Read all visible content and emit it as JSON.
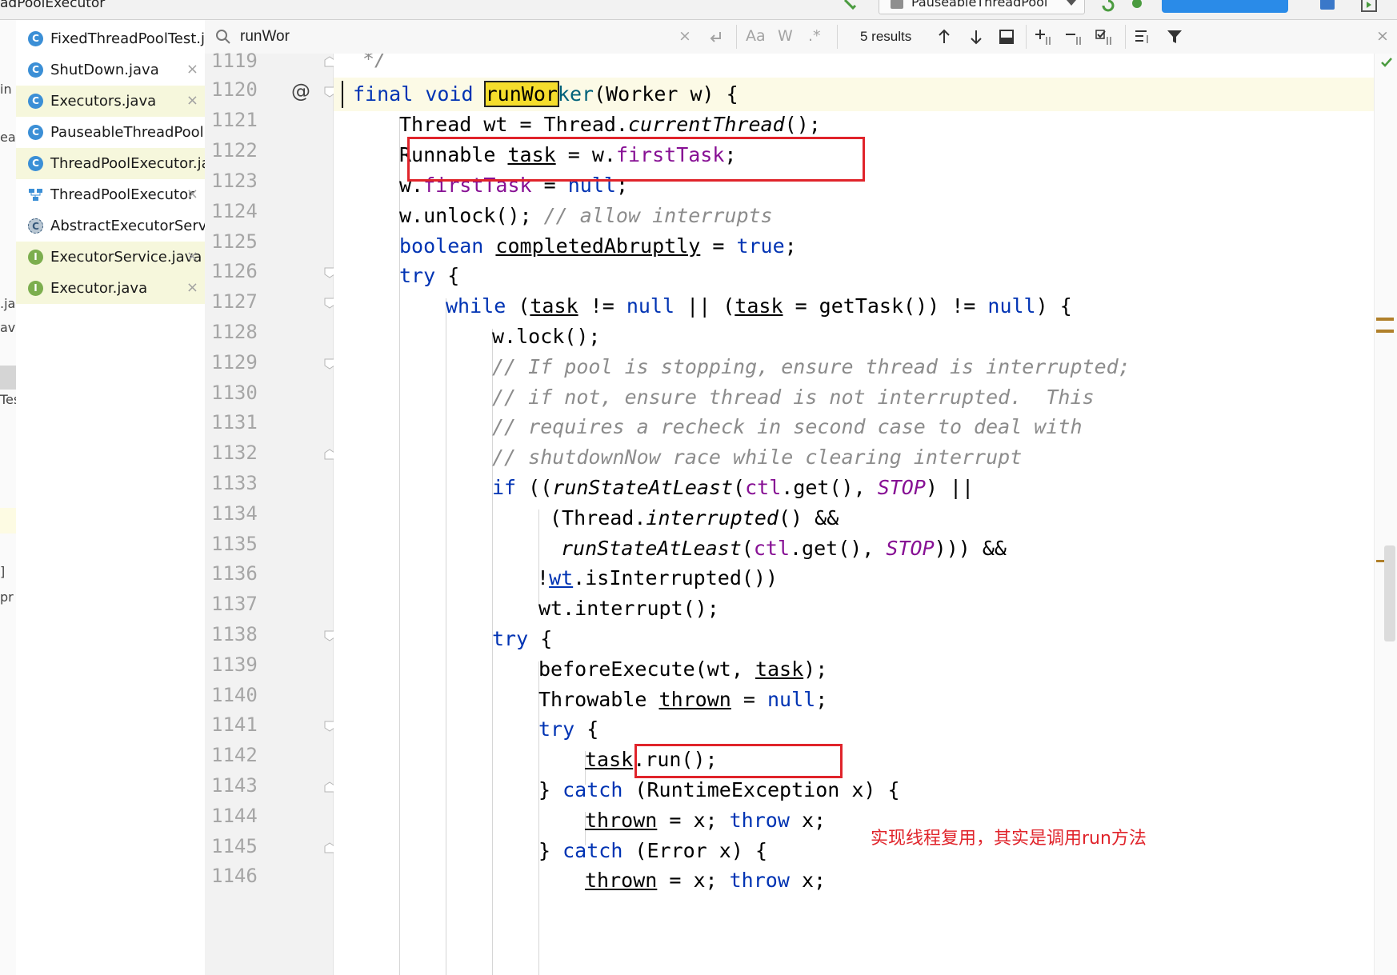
{
  "window": {
    "title_fragment": "adPoolExecutor",
    "run_config": "PauseableThreadPool"
  },
  "left_fragments": [
    "in",
    "ea",
    ".ja",
    "ava",
    "Tes",
    "]",
    "pr"
  ],
  "file_tabs": [
    {
      "name": "FixedThreadPoolTest.ja",
      "icon": "class-icon",
      "closable": false,
      "highlight": false
    },
    {
      "name": "ShutDown.java",
      "icon": "class-icon",
      "closable": true,
      "highlight": false
    },
    {
      "name": "Executors.java",
      "icon": "class-icon",
      "closable": true,
      "highlight": true
    },
    {
      "name": "PauseableThreadPool.j",
      "icon": "class-icon",
      "closable": false,
      "highlight": false
    },
    {
      "name": "ThreadPoolExecutor.ja",
      "icon": "class-icon",
      "closable": false,
      "highlight": true
    },
    {
      "name": "ThreadPoolExecutor",
      "icon": "diagram-icon",
      "closable": true,
      "highlight": false
    },
    {
      "name": "AbstractExecutorServic",
      "icon": "abstract-class-icon",
      "closable": false,
      "highlight": false
    },
    {
      "name": "ExecutorService.java",
      "icon": "interface-icon",
      "closable": true,
      "highlight": true
    },
    {
      "name": "Executor.java",
      "icon": "interface-icon",
      "closable": true,
      "highlight": true
    }
  ],
  "search": {
    "query": "runWor",
    "results": "5 results",
    "match_case_label": "Aa",
    "words_label": "W",
    "regex_label": ".*"
  },
  "line_numbers": [
    "1119",
    "1120",
    "1121",
    "1122",
    "1123",
    "1124",
    "1125",
    "1126",
    "1127",
    "1128",
    "1129",
    "1130",
    "1131",
    "1132",
    "1133",
    "1134",
    "1135",
    "1136",
    "1137",
    "1138",
    "1139",
    "1140",
    "1141",
    "1142",
    "1143",
    "1144",
    "1145",
    "1146"
  ],
  "gutter": {
    "override_marker": "@"
  },
  "code": {
    "l1119": "*/",
    "l1120_kw1": "final",
    "l1120_kw2": "void",
    "l1120_match": "runWor",
    "l1120_name_rest": "ker",
    "l1120_params": "(Worker w) {",
    "l1121_a": "Thread ",
    "l1121_var": "wt",
    "l1121_b": " = Thread.",
    "l1121_m": "currentThread",
    "l1121_c": "();",
    "l1122_a": "Runnable ",
    "l1122_var": "task",
    "l1122_b": " = w.",
    "l1122_fld": "firstTask",
    "l1122_c": ";",
    "l1123_a": "w.",
    "l1123_fld": "firstTask",
    "l1123_b": " = ",
    "l1123_kw": "null",
    "l1123_c": ";",
    "l1124_a": "w.unlock(); ",
    "l1124_cmt": "// allow interrupts",
    "l1125_kw": "boolean",
    "l1125_sp": " ",
    "l1125_var": "completedAbruptly",
    "l1125_b": " = ",
    "l1125_kw2": "true",
    "l1125_c": ";",
    "l1126_kw": "try",
    "l1126_b": " {",
    "l1127_kw": "while",
    "l1127_a": " (",
    "l1127_v1": "task",
    "l1127_b": " != ",
    "l1127_kw2": "null",
    "l1127_c": " || (",
    "l1127_v2": "task",
    "l1127_d": " = getTask()) != ",
    "l1127_kw3": "null",
    "l1127_e": ") {",
    "l1128": "w.lock();",
    "l1129": "// If pool is stopping, ensure thread is interrupted;",
    "l1130": "// if not, ensure thread is not interrupted.  This",
    "l1131": "// requires a recheck in second case to deal with",
    "l1132": "// shutdownNow race while clearing interrupt",
    "l1133_kw": "if",
    "l1133_a": " ((",
    "l1133_m": "runStateAtLeast",
    "l1133_b": "(",
    "l1133_f": "ctl",
    "l1133_c": ".get(), ",
    "l1133_s": "STOP",
    "l1133_d": ") ||",
    "l1134_a": "(Thread.",
    "l1134_m": "interrupted",
    "l1134_b": "() &&",
    "l1135_m": "runStateAtLeast",
    "l1135_a": "(",
    "l1135_f": "ctl",
    "l1135_b": ".get(), ",
    "l1135_s": "STOP",
    "l1135_c": "))) &&",
    "l1136_a": "!",
    "l1136_v": "wt",
    "l1136_b": ".isInterrupted())",
    "l1137": "wt.interrupt();",
    "l1138_kw": "try",
    "l1138_b": " {",
    "l1139_a": "beforeExecute(wt, ",
    "l1139_v": "task",
    "l1139_b": ");",
    "l1140_a": "Throwable ",
    "l1140_v": "thrown",
    "l1140_b": " = ",
    "l1140_kw": "null",
    "l1140_c": ";",
    "l1141_kw": "try",
    "l1141_b": " {",
    "l1142_v": "task",
    "l1142_a": ".run();",
    "l1143_a": "} ",
    "l1143_kw": "catch",
    "l1143_b": " (RuntimeException x) {",
    "l1144_v": "thrown",
    "l1144_a": " = x; ",
    "l1144_kw": "throw",
    "l1144_b": " x;",
    "l1145_a": "} ",
    "l1145_kw": "catch",
    "l1145_b": " (Error x) {",
    "l1146_v": "thrown",
    "l1146_a": " = x; ",
    "l1146_kw": "throw",
    "l1146_b": " x;"
  },
  "annotation": "实现线程复用，其实是调用run方法",
  "colors": {
    "keyword": "#0033b3",
    "field": "#871094",
    "comment": "#8c8c8c",
    "search_match": "#f5dd2c",
    "annotation_red": "#e0242b"
  }
}
